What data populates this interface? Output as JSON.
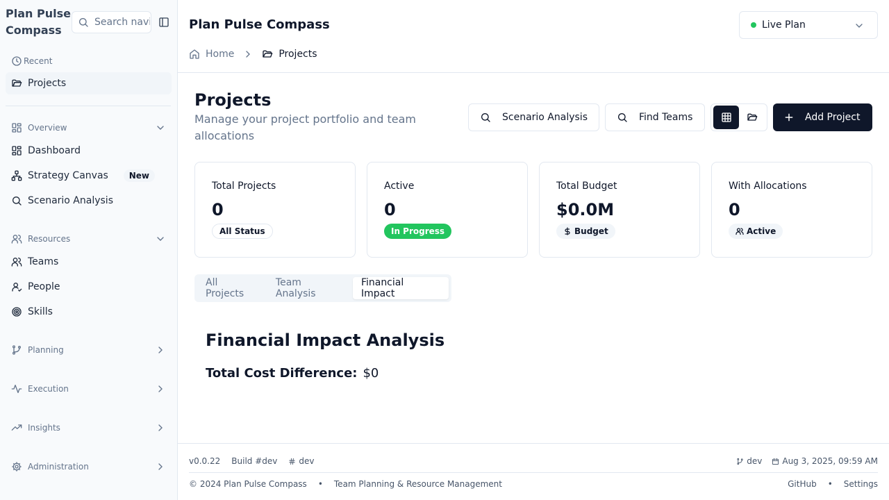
{
  "sidebar": {
    "brand": "Plan Pulse Compass",
    "search_placeholder": "Search navigation...",
    "recent_label": "Recent",
    "recent_items": [
      {
        "label": "Projects"
      }
    ],
    "groups": [
      {
        "label": "Overview",
        "expanded": true,
        "items": [
          {
            "label": "Dashboard"
          },
          {
            "label": "Strategy Canvas",
            "badge": "New"
          },
          {
            "label": "Scenario Analysis"
          }
        ]
      },
      {
        "label": "Resources",
        "expanded": true,
        "items": [
          {
            "label": "Teams"
          },
          {
            "label": "People"
          },
          {
            "label": "Skills"
          }
        ]
      },
      {
        "label": "Planning",
        "expanded": false
      },
      {
        "label": "Execution",
        "expanded": false
      },
      {
        "label": "Insights",
        "expanded": false
      },
      {
        "label": "Administration",
        "expanded": false
      }
    ]
  },
  "header": {
    "title": "Plan Pulse Compass",
    "plan_select": {
      "value": "Live Plan",
      "status_color": "#22c55e"
    },
    "breadcrumb": [
      {
        "label": "Home"
      },
      {
        "label": "Projects"
      }
    ]
  },
  "page": {
    "title": "Projects",
    "subtitle": "Manage your project portfolio and team allocations",
    "actions": {
      "scenario": "Scenario Analysis",
      "find_teams": "Find Teams",
      "add_project": "Add Project"
    }
  },
  "stats": [
    {
      "label": "Total Projects",
      "value": "0",
      "badge": "All Status"
    },
    {
      "label": "Active",
      "value": "0",
      "badge": "In Progress"
    },
    {
      "label": "Total Budget",
      "value": "$0.0M",
      "badge": "Budget"
    },
    {
      "label": "With Allocations",
      "value": "0",
      "badge": "Active"
    }
  ],
  "tabs": [
    {
      "label": "All Projects",
      "active": false
    },
    {
      "label": "Team Analysis",
      "active": false
    },
    {
      "label": "Financial Impact",
      "active": true
    }
  ],
  "financial": {
    "title": "Financial Impact Analysis",
    "cost_label": "Total Cost Difference:",
    "cost_value": "$0"
  },
  "footer": {
    "version": "v0.0.22",
    "build": "Build #dev",
    "hash": "dev",
    "branch": "dev",
    "timestamp": "Aug 3, 2025, 09:59 AM",
    "copyright": "© 2024 Plan Pulse Compass",
    "bullet": "•",
    "tagline": "Team Planning & Resource Management",
    "github": "GitHub",
    "settings": "Settings"
  },
  "colors": {
    "primary": "#0f172a",
    "success": "#22c55e",
    "muted": "#64748b",
    "border": "#e2e8f0"
  }
}
